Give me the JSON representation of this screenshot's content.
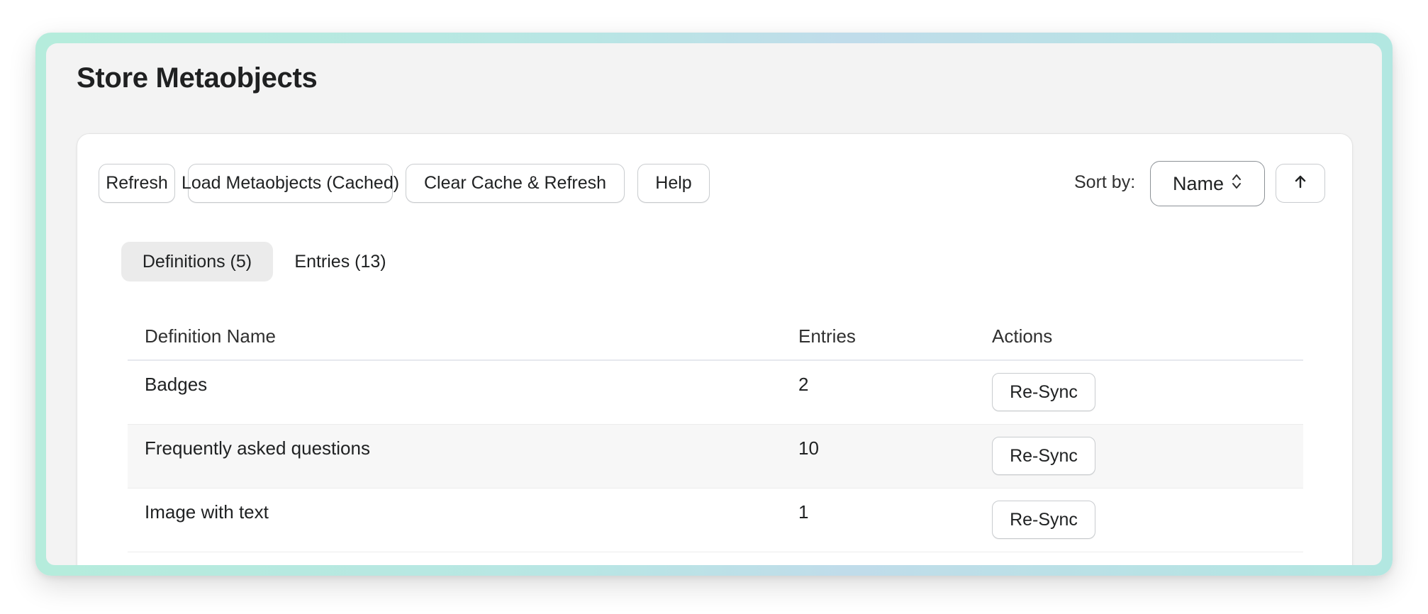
{
  "page": {
    "title": "Store Metaobjects"
  },
  "toolbar": {
    "refresh_label": "Refresh",
    "load_cached_label": "Load Metaobjects (Cached)",
    "clear_cache_label": "Clear Cache & Refresh",
    "help_label": "Help",
    "sort_label": "Sort by:",
    "sort_value": "Name",
    "sort_direction_icon": "arrow-up-icon"
  },
  "tabs": [
    {
      "label": "Definitions (5)",
      "active": true
    },
    {
      "label": "Entries (13)",
      "active": false
    }
  ],
  "table": {
    "columns": [
      "Definition Name",
      "Entries",
      "Actions"
    ],
    "rows": [
      {
        "name": "Badges",
        "entries": "2",
        "action": "Re-Sync"
      },
      {
        "name": "Frequently asked questions",
        "entries": "10",
        "action": "Re-Sync"
      },
      {
        "name": "Image with text",
        "entries": "1",
        "action": "Re-Sync"
      }
    ]
  },
  "colors": {
    "frame_gradient": [
      "#b5ecdc",
      "#c0dcea",
      "#b2e7e1"
    ],
    "page_background": "#f3f3f3",
    "card_background": "#ffffff",
    "active_tab_background": "#ebebeb"
  }
}
